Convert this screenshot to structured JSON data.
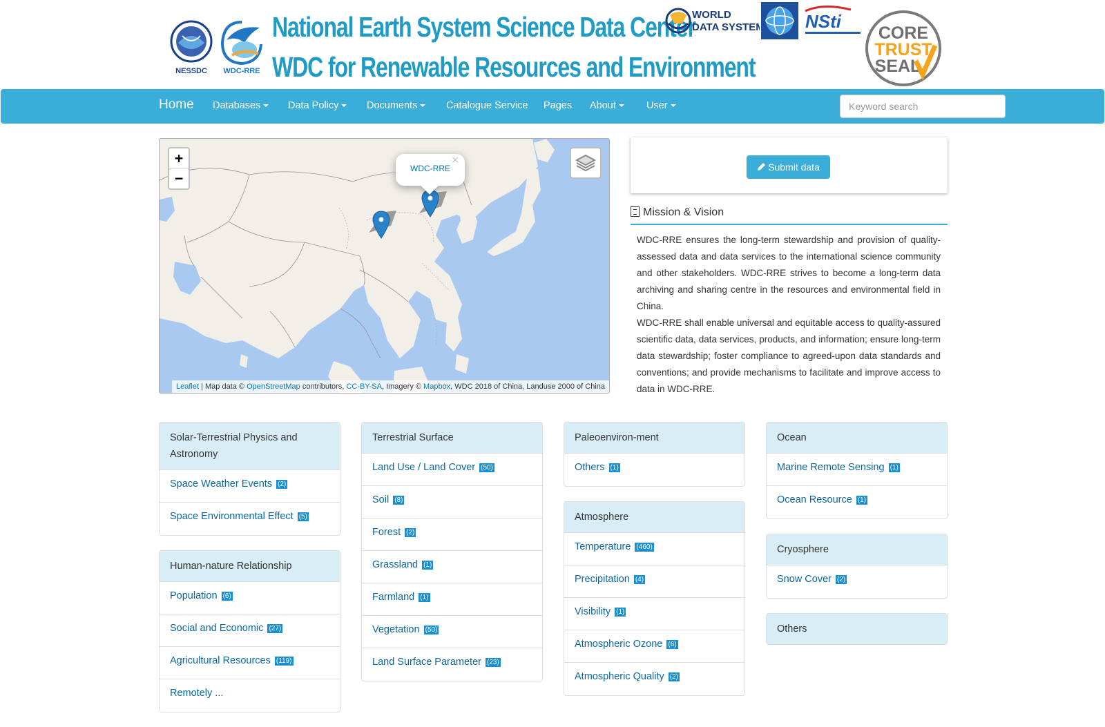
{
  "banner": {
    "nessdc_label": "NESSDC",
    "wdcrre_label": "WDC-RRE",
    "title_line1": "National Earth System Science Data Center",
    "title_line2": "WDC for Renewable Resources and Environment",
    "wds_line1": "WORLD",
    "wds_line2": "DATA SYSTEM",
    "nsti_label": "NSti",
    "cts_line1": "CORE",
    "cts_line2": "TRUST",
    "cts_line3": "SEAL",
    "colors": {
      "title": "#1f9bc6",
      "navbar": "#3aaed8",
      "panel_head": "#d9edf7",
      "link": "#0a66a0",
      "badge": "#1a8fd0"
    }
  },
  "nav": {
    "home": "Home",
    "items": [
      "Databases",
      "Data Policy",
      "Documents",
      "Catalogue Service",
      "Pages",
      "About",
      "User"
    ],
    "search_placeholder": "Keyword search"
  },
  "map": {
    "zoom_in": "+",
    "zoom_out": "−",
    "popup_label": "WDC-RRE",
    "popup_close": "×",
    "attribution": {
      "leaflet": "Leaflet",
      "sep": " | Map data © ",
      "osm": "OpenStreetMap",
      "contrib": " contributors, ",
      "ccbysa": "CC-BY-SA",
      "imagery": ", Imagery © ",
      "mapbox": "Mapbox",
      "rest": ", WDC 2018 of China, Landuse 2000 of China"
    },
    "icons": {
      "layers": "layers-icon",
      "marker": "map-marker-icon"
    }
  },
  "right": {
    "submit_label": "Submit data",
    "mission_title": "Mission & Vision",
    "mission_p1": "WDC-RRE ensures the long-term stewardship and provision of quality-assessed data and data services to the international science community and other stakeholders. WDC-RRE strives to become a long-term data archiving and sharing centre in the resources and environmental field in China.",
    "mission_p2": "WDC-RRE shall enable universal and equitable access to quality-assured scientific data, data services, products, and information; ensure long-term data stewardship; foster compliance to agreed-upon data standards and conventions; and provide mechanisms to facilitate and improve access to data in WDC-RRE."
  },
  "categories": {
    "c1": [
      {
        "title": "Solar-Terrestrial Physics and Astronomy",
        "items": [
          {
            "label": "Space Weather Events",
            "count": "(2)"
          },
          {
            "label": "Space Environmental Effect",
            "count": "(5)"
          }
        ]
      },
      {
        "title": "Human-nature Relationship",
        "items": [
          {
            "label": "Population",
            "count": "(6)"
          },
          {
            "label": "Social and Economic",
            "count": "(27)"
          },
          {
            "label": "Agricultural Resources",
            "count": "(119)"
          },
          {
            "label": "Remotely ...",
            "count": ""
          }
        ]
      }
    ],
    "c2": [
      {
        "title": "Terrestrial Surface",
        "items": [
          {
            "label": "Land Use / Land Cover",
            "count": "(50)"
          },
          {
            "label": "Soil",
            "count": "(8)"
          },
          {
            "label": "Forest",
            "count": "(2)"
          },
          {
            "label": "Grassland",
            "count": "(1)"
          },
          {
            "label": "Farmland",
            "count": "(1)"
          },
          {
            "label": "Vegetation",
            "count": "(50)"
          },
          {
            "label": "Land Surface Parameter",
            "count": "(23)"
          }
        ]
      }
    ],
    "c3": [
      {
        "title": "Paleoenviron-ment",
        "items": [
          {
            "label": "Others",
            "count": "(1)"
          }
        ]
      },
      {
        "title": "Atmosphere",
        "items": [
          {
            "label": "Temperature",
            "count": "(460)"
          },
          {
            "label": "Precipitation",
            "count": "(4)"
          },
          {
            "label": "Visibility",
            "count": "(1)"
          },
          {
            "label": "Atmospheric Ozone",
            "count": "(6)"
          },
          {
            "label": "Atmospheric Quality",
            "count": "(2)"
          }
        ]
      }
    ],
    "c4": [
      {
        "title": "Ocean",
        "items": [
          {
            "label": "Marine Remote Sensing",
            "count": "(1)"
          },
          {
            "label": "Ocean Resource",
            "count": "(1)"
          }
        ]
      },
      {
        "title": "Cryosphere",
        "items": [
          {
            "label": "Snow Cover",
            "count": "(2)"
          }
        ]
      },
      {
        "title": "Others",
        "items": []
      }
    ]
  }
}
